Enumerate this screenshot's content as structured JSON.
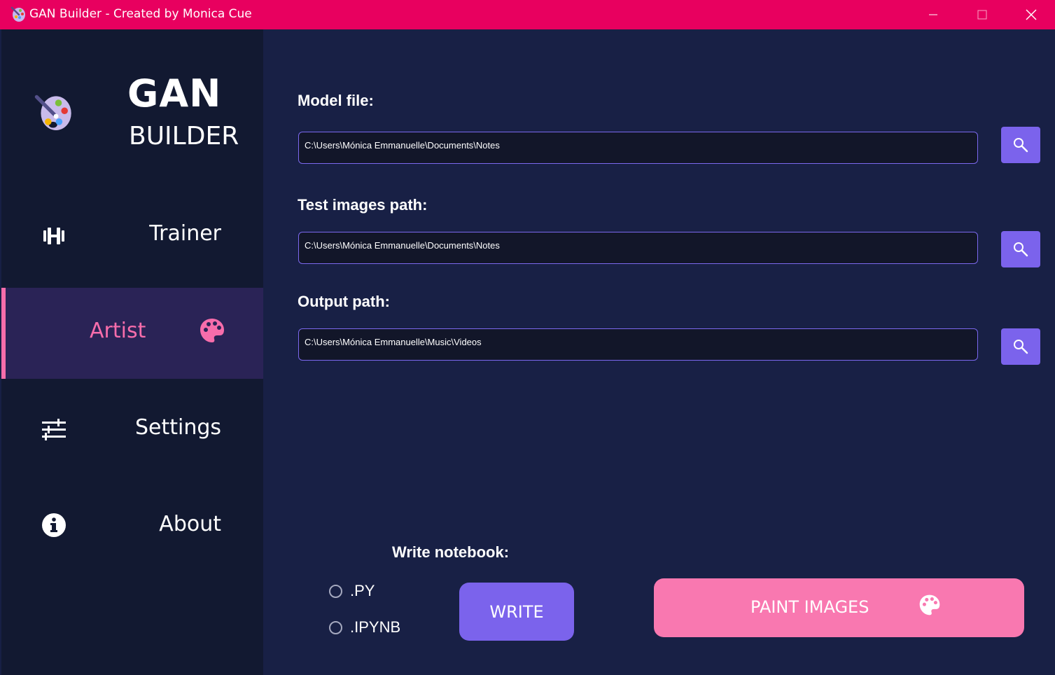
{
  "window": {
    "title": "GAN Builder - Created by Monica Cue",
    "titlebar_color": "#e8005f"
  },
  "sidebar": {
    "logo_line1": "GAN",
    "logo_line2": "BUILDER",
    "items": [
      {
        "label": "Trainer",
        "icon": "dumbbell-icon",
        "active": false
      },
      {
        "label": "Artist",
        "icon": "palette-icon",
        "active": true
      },
      {
        "label": "Settings",
        "icon": "sliders-icon",
        "active": false
      },
      {
        "label": "About",
        "icon": "info-icon",
        "active": false
      }
    ]
  },
  "main": {
    "model_file": {
      "label": "Model file:",
      "value": "C:\\Users\\Mónica Emmanuelle\\Documents\\Notes"
    },
    "test_images": {
      "label": "Test images path:",
      "value": "C:\\Users\\Mónica Emmanuelle\\Documents\\Notes"
    },
    "output_path": {
      "label": "Output path:",
      "value": "C:\\Users\\Mónica Emmanuelle\\Music\\Videos"
    },
    "write_notebook": {
      "label": "Write notebook:",
      "options": [
        ".PY",
        ".IPYNB"
      ],
      "button": "WRITE"
    },
    "paint_button": "PAINT IMAGES"
  },
  "colors": {
    "accent_purple": "#7b63ec",
    "accent_pink": "#f978b0",
    "background": "#182045",
    "sidebar": "#121931"
  }
}
